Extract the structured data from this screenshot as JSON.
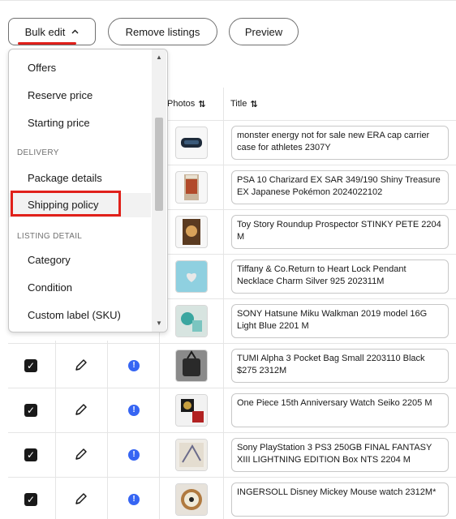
{
  "toolbar": {
    "bulk_edit_label": "Bulk edit",
    "remove_label": "Remove listings",
    "preview_label": "Preview"
  },
  "dropdown": {
    "items": [
      {
        "label": "Offers"
      },
      {
        "label": "Reserve price"
      },
      {
        "label": "Starting price"
      }
    ],
    "section_delivery": "DELIVERY",
    "delivery_items": [
      {
        "label": "Package details"
      },
      {
        "label": "Shipping policy"
      }
    ],
    "section_listing": "LISTING DETAIL",
    "listing_items": [
      {
        "label": "Category"
      },
      {
        "label": "Condition"
      },
      {
        "label": "Custom label (SKU)"
      }
    ]
  },
  "table": {
    "photos_header": "Photos",
    "title_header": "Title",
    "sort_icon": "⇅",
    "rows": [
      {
        "title": "monster energy not for sale new ERA cap carrier case for athletes 2307Y"
      },
      {
        "title": "PSA 10 Charizard EX SAR 349/190 Shiny Treasure EX Japanese Pokémon 2024022102"
      },
      {
        "title": "Toy Story Roundup Prospector STINKY PETE 2204 M"
      },
      {
        "title": "Tiffany & Co.Return to Heart Lock Pendant Necklace Charm Silver 925 202311M"
      },
      {
        "title": "SONY Hatsune Miku Walkman 2019 model 16G Light Blue 2201 M"
      },
      {
        "title": "TUMI Alpha 3 Pocket Bag Small 2203110 Black $275 2312M"
      },
      {
        "title": "One Piece 15th Anniversary Watch Seiko 2205 M"
      },
      {
        "title": "Sony PlayStation 3 PS3 250GB FINAL FANTASY XIII LIGHTNING EDITION Box NTS 2204 M"
      },
      {
        "title": "INGERSOLL Disney Mickey Mouse watch 2312M*"
      }
    ]
  },
  "colors": {
    "accent_red": "#e0201a",
    "info_blue": "#3665f3"
  }
}
